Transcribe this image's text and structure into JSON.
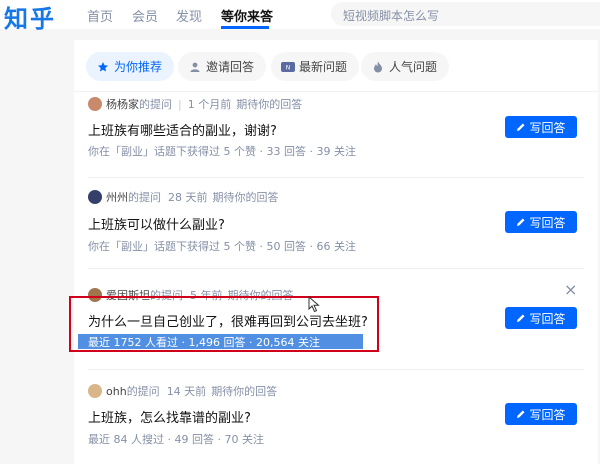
{
  "header": {
    "logo": "知乎",
    "nav": [
      "首页",
      "会员",
      "发现",
      "等你来答"
    ],
    "search_placeholder": "短视频脚本怎么写"
  },
  "tabs": [
    {
      "label": "为你推荐",
      "icon": "star-icon"
    },
    {
      "label": "邀请回答",
      "icon": "user-icon"
    },
    {
      "label": "最新问题",
      "icon": "new-badge-icon"
    },
    {
      "label": "人气问题",
      "icon": "fire-icon"
    }
  ],
  "questions": [
    {
      "asker": "杨杨家",
      "asker_suffix": " 的提问",
      "time": "1 个月前",
      "status": "期待你的回答",
      "title": "上班族有哪些适合的副业，谢谢?",
      "stats": "你在「副业」话题下获得过 5 个赞 · 33 回答 · 39 关注",
      "avatar_color": "#c98a6b"
    },
    {
      "asker": "州州",
      "asker_suffix": " 的提问",
      "time": "28 天前",
      "status": "期待你的回答",
      "title": "上班族可以做什么副业?",
      "stats": "你在「副业」话题下获得过 5 个赞 · 50 回答 · 66 关注",
      "avatar_color": "#35406a"
    },
    {
      "asker": "爱因斯坦",
      "asker_suffix": " 的提问",
      "time": "5 年前",
      "status": "期待你的回答",
      "title": "为什么一旦自己创业了，很难再回到公司去坐班?",
      "stats": "最近 1752 人看过 · 1,496 回答 · 20,564 关注",
      "avatar_color": "#a0764f"
    },
    {
      "asker": "ohh",
      "asker_suffix": " 的提问",
      "time": "14 天前",
      "status": "期待你的回答",
      "title": "上班族，怎么找靠谱的副业?",
      "stats": "最近 84 人搜过 · 49 回答 · 70 关注",
      "avatar_color": "#d8b68a"
    }
  ],
  "answer_button_label": "写回答",
  "close_symbol": "×",
  "colors": {
    "brand": "#0066ff",
    "logo": "#1677e6",
    "annotation_box": "#d0021b",
    "selection": "#1f6fd8"
  }
}
